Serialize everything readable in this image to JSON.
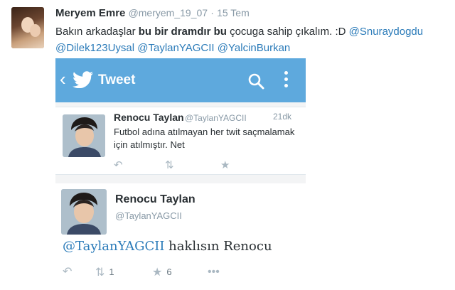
{
  "tweet": {
    "name": "Meryem Emre",
    "handle": "@meryem_19_07",
    "separator": "·",
    "date": "15 Tem",
    "text": {
      "part1": "Bakın arkadaşlar ",
      "bold": "bu bir dramdır bu",
      "part2": " çocuga sahip çıkalım. :D ",
      "mentions": [
        "@Snuraydogdu",
        "@Dilek123Uysal",
        "@TaylanYAGCII",
        "@YalcinBurkan"
      ]
    },
    "actions": {
      "retweet_count": "1",
      "favorite_count": "6"
    }
  },
  "screenshot": {
    "topbar": {
      "back": "‹",
      "title": "Tweet",
      "color": "#5ea9dd"
    },
    "card": {
      "name": "Renocu Taylan",
      "handle": "@TaylanYAGCII",
      "time": "21dk",
      "text": "Futbol adına atılmayan her twit saçmalamak için atılmıştır.  Net"
    },
    "detail": {
      "name": "Renocu Taylan",
      "handle": "@TaylanYAGCII",
      "reply_mention": "@TaylanYAGCII",
      "reply_text": " haklısın Renocu"
    }
  },
  "colors": {
    "link": "#2b7bb9",
    "muted": "#8899a6"
  }
}
